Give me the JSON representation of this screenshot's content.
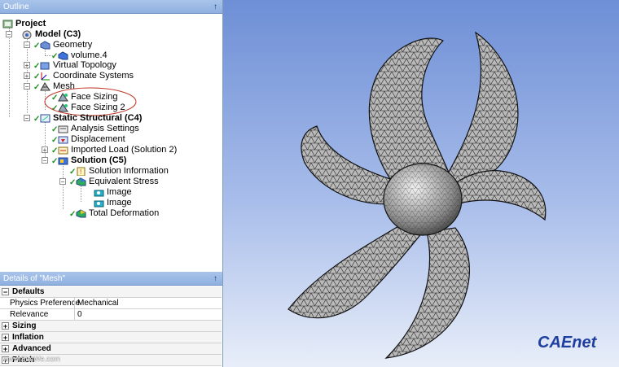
{
  "outline": {
    "title": "Outline",
    "pin": "↑",
    "nodes": {
      "project": "Project",
      "model": "Model (C3)",
      "geometry": "Geometry",
      "volume": "volume.4",
      "virtual_topology": "Virtual Topology",
      "coordinate_systems": "Coordinate Systems",
      "mesh": "Mesh",
      "face_sizing": "Face Sizing",
      "face_sizing_2": "Face Sizing 2",
      "static_structural": "Static Structural (C4)",
      "analysis_settings": "Analysis Settings",
      "displacement": "Displacement",
      "imported_load": "Imported Load (Solution 2)",
      "solution": "Solution (C5)",
      "solution_information": "Solution Information",
      "equivalent_stress": "Equivalent Stress",
      "image_1": "Image",
      "image_2": "Image",
      "total_deformation": "Total Deformation"
    }
  },
  "details": {
    "title": "Details of \"Mesh\"",
    "pin": "↑",
    "groups": {
      "defaults": "Defaults",
      "sizing": "Sizing",
      "inflation": "Inflation",
      "advanced": "Advanced",
      "pinch": "Pinch"
    },
    "rows": [
      {
        "key": "Physics Preference",
        "value": "Mechanical"
      },
      {
        "key": "Relevance",
        "value": "0"
      }
    ]
  },
  "watermarks": {
    "left": "www.SimWe.com",
    "right": "CAEnet"
  },
  "colors": {
    "title_bar": "#8fb0e0",
    "viewport_top": "#6e8fd6",
    "viewport_bottom": "#e8eef9",
    "highlight_ellipse": "#c0392b"
  }
}
